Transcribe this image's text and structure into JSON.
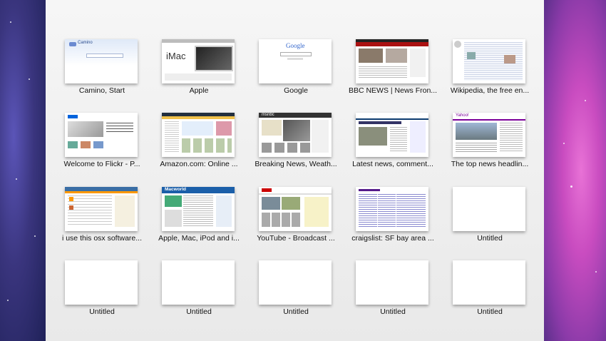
{
  "tiles": [
    {
      "label": "Camino, Start"
    },
    {
      "label": "Apple"
    },
    {
      "label": "Google"
    },
    {
      "label": "BBC NEWS | News Fron..."
    },
    {
      "label": "Wikipedia, the free en..."
    },
    {
      "label": "Welcome to Flickr - P..."
    },
    {
      "label": "Amazon.com: Online ..."
    },
    {
      "label": "Breaking News, Weath..."
    },
    {
      "label": "Latest news, comment..."
    },
    {
      "label": "The top news headlin..."
    },
    {
      "label": "i use this osx software..."
    },
    {
      "label": "Apple, Mac, iPod and i..."
    },
    {
      "label": "YouTube - Broadcast ..."
    },
    {
      "label": "craigslist: SF bay area ..."
    },
    {
      "label": "Untitled"
    },
    {
      "label": "Untitled"
    },
    {
      "label": "Untitled"
    },
    {
      "label": "Untitled"
    },
    {
      "label": "Untitled"
    },
    {
      "label": "Untitled"
    }
  ],
  "thumb_text": {
    "camino": "Camino",
    "apple_mac": "iMac",
    "google": "Google",
    "msnbc": "msnbc",
    "macworld": "Macworld",
    "yahoo": "Yahoo!"
  }
}
